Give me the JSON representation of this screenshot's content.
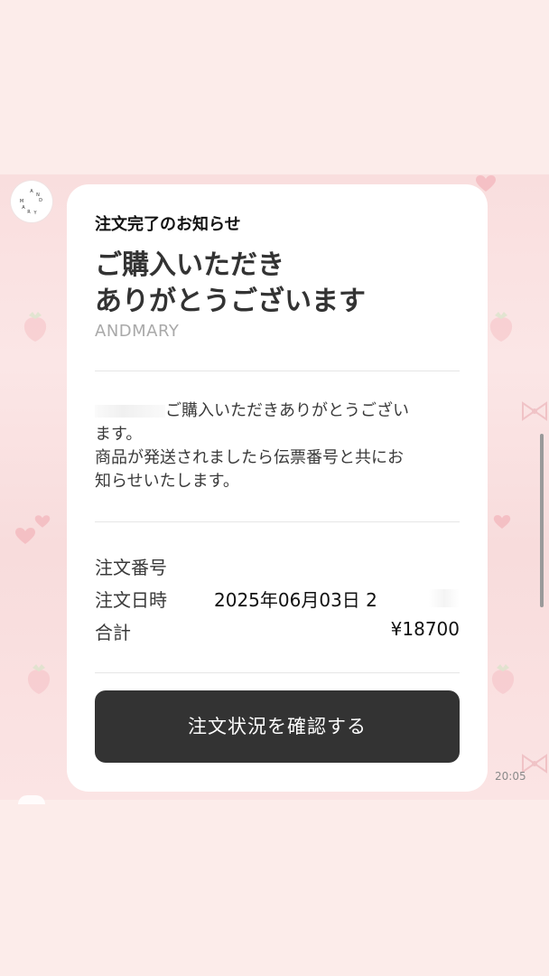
{
  "brand_logo_text": "ANDMARY",
  "card": {
    "label": "注文完了のお知らせ",
    "title_line1": "ご購入いただき",
    "title_line2": "ありがとうございます",
    "brand": "ANDMARY",
    "message_line1": "ご購入いただきありがとうござい",
    "message_line2": "ます。",
    "message_line3": "商品が発送されましたら伝票番号と共にお",
    "message_line4": "知らせいたします。",
    "order_number_label": "注文番号",
    "order_date_label": "注文日時",
    "order_date_value": "2025年06月03日 2",
    "total_label": "合計",
    "total_value": "¥18700",
    "cta_label": "注文状況を確認する"
  },
  "timestamp": "20:05",
  "colors": {
    "background": "#fcecea",
    "card": "#ffffff",
    "button": "#333333",
    "accent": "#f4b8bf"
  }
}
